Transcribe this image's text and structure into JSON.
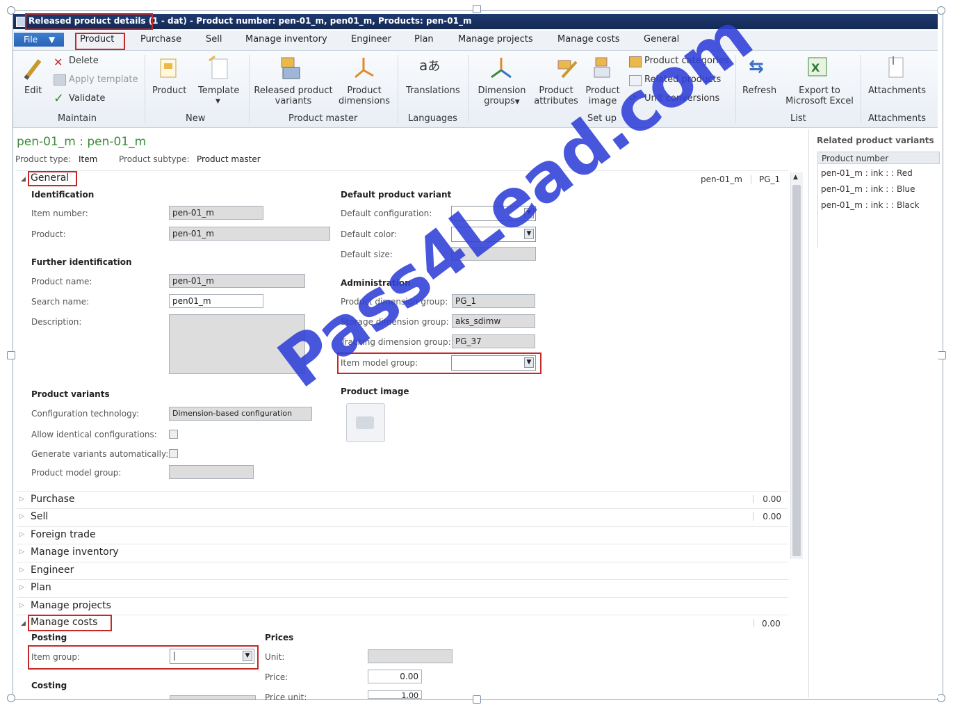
{
  "window": {
    "title_highlight": "Released product details",
    "title_rest": " (1 - dat) - Product number: pen-01_m, pen01_m, Products: pen-01_m"
  },
  "menu": {
    "file": "File",
    "tabs": [
      "Product",
      "Purchase",
      "Sell",
      "Manage inventory",
      "Engineer",
      "Plan",
      "Manage projects",
      "Manage costs",
      "General"
    ]
  },
  "ribbon": {
    "maintain": {
      "edit": "Edit",
      "delete": "Delete",
      "apply_template": "Apply template",
      "validate": "Validate",
      "group": "Maintain"
    },
    "new": {
      "product": "Product",
      "template": "Template",
      "group": "New"
    },
    "product_master": {
      "released_variants_1": "Released product",
      "released_variants_2": "variants",
      "dimensions_1": "Product",
      "dimensions_2": "dimensions",
      "group": "Product master"
    },
    "languages": {
      "translations": "Translations",
      "group": "Languages"
    },
    "setup": {
      "dim_groups_1": "Dimension",
      "dim_groups_2": "groups",
      "attributes_1": "Product",
      "attributes_2": "attributes",
      "image_1": "Product",
      "image_2": "image",
      "categories": "Product categories",
      "related": "Related products",
      "unit_conv": "Unit conversions",
      "group": "Set up"
    },
    "list": {
      "refresh": "Refresh",
      "export_1": "Export to",
      "export_2": "Microsoft Excel",
      "group": "List"
    },
    "attachments": {
      "attachments": "Attachments",
      "group": "Attachments"
    }
  },
  "header": {
    "title": "pen-01_m : pen-01_m",
    "type_label": "Product type:",
    "type_value": "Item",
    "subtype_label": "Product subtype:",
    "subtype_value": "Product master",
    "summary_1": "pen-01_m",
    "summary_2": "PG_1"
  },
  "general": {
    "title": "General",
    "identification": "Identification",
    "item_number_label": "Item number:",
    "item_number": "pen-01_m",
    "product_label": "Product:",
    "product": "pen-01_m",
    "further": "Further identification",
    "product_name_label": "Product name:",
    "product_name": "pen-01_m",
    "search_name_label": "Search name:",
    "search_name": "pen01_m",
    "description_label": "Description:",
    "variants": "Product variants",
    "config_tech_label": "Configuration technology:",
    "config_tech": "Dimension-based configuration",
    "allow_identical_label": "Allow identical configurations:",
    "generate_label": "Generate variants automatically:",
    "model_group_label": "Product model group:",
    "default_variant": "Default product variant",
    "default_config_label": "Default configuration:",
    "default_color_label": "Default color:",
    "default_size_label": "Default size:",
    "administration": "Administration",
    "dim_group_label": "Product dimension group:",
    "dim_group": "PG_1",
    "storage_label": "Storage dimension group:",
    "storage": "aks_sdimw",
    "tracking_label": "Tracking dimension group:",
    "tracking": "PG_37",
    "item_model_label": "Item model group:",
    "product_image": "Product image"
  },
  "fasttabs": [
    {
      "title": "Purchase",
      "value": "0.00"
    },
    {
      "title": "Sell",
      "value": "0.00"
    },
    {
      "title": "Foreign trade",
      "value": ""
    },
    {
      "title": "Manage inventory",
      "value": ""
    },
    {
      "title": "Engineer",
      "value": ""
    },
    {
      "title": "Plan",
      "value": ""
    },
    {
      "title": "Manage projects",
      "value": ""
    }
  ],
  "manage_costs": {
    "title": "Manage costs",
    "value": "0.00",
    "posting": "Posting",
    "item_group_label": "Item group:",
    "item_group": "|",
    "prices": "Prices",
    "unit_label": "Unit:",
    "price_label": "Price:",
    "price": "0.00",
    "price_unit_label": "Price unit:",
    "price_unit": "1.00",
    "costing": "Costing"
  },
  "side_panel": {
    "title": "Related product variants",
    "column": "Product number",
    "rows": [
      "pen-01_m : ink : : Red",
      "pen-01_m : ink : : Blue",
      "pen-01_m : ink : : Black"
    ]
  },
  "watermark": "Pass4Lead.com",
  "colors": {
    "title_bar": "#1e3a70",
    "accent_green": "#3a8a3a",
    "highlight_red": "#c62828",
    "watermark": "#2f3fd8"
  }
}
